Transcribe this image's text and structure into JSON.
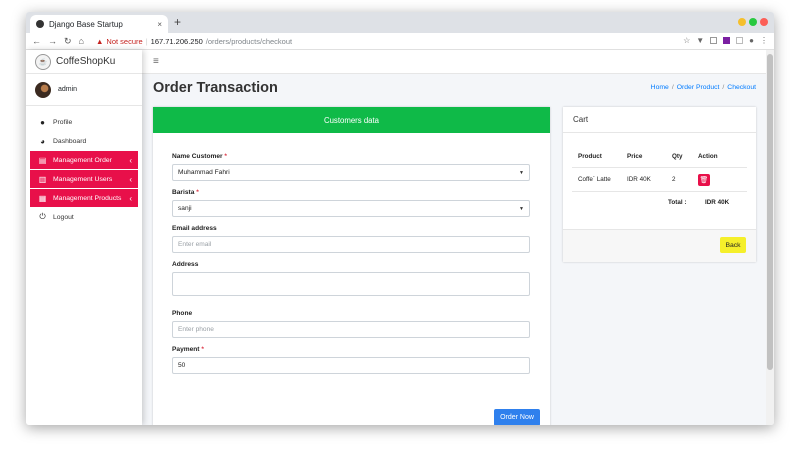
{
  "browser": {
    "tab_title": "Django Base Startup",
    "tab_close": "×",
    "new_tab": "+",
    "not_secure": "Not secure",
    "url_host": "167.71.206.250",
    "url_path": "/orders/products/checkout",
    "traffic_colors": [
      "#f5bf2c",
      "#29c940",
      "#fc5f57"
    ]
  },
  "sidebar": {
    "brand": "CoffeShopKu",
    "user": "admin",
    "items": [
      {
        "label": "Profile",
        "icon": "user-icon",
        "glyph": "👤",
        "active": false
      },
      {
        "label": "Dashboard",
        "icon": "dashboard-icon",
        "glyph": "◕",
        "active": false
      },
      {
        "label": "Management Order",
        "icon": "orders-icon",
        "glyph": "▤",
        "active": true
      },
      {
        "label": "Management Users",
        "icon": "users-icon",
        "glyph": "👥",
        "active": true
      },
      {
        "label": "Management Products",
        "icon": "boxes-icon",
        "glyph": "▦",
        "active": true
      },
      {
        "label": "Logout",
        "icon": "power-icon",
        "glyph": "⏻",
        "active": false
      }
    ]
  },
  "header": {
    "page_title": "Order Transaction",
    "breadcrumb": [
      "Home",
      "Order Product",
      "Checkout"
    ]
  },
  "customer_form": {
    "title": "Customers data",
    "name_label": "Name Customer",
    "name_value": "Muhammad Fahri",
    "barista_label": "Barista",
    "barista_value": "sanji",
    "email_label": "Email address",
    "email_placeholder": "Enter email",
    "address_label": "Address",
    "address_value": "",
    "phone_label": "Phone",
    "phone_placeholder": "Enter phone",
    "payment_label": "Payment",
    "payment_value": "50",
    "required_mark": "*",
    "submit_label": "Order Now"
  },
  "cart": {
    "title": "Cart",
    "columns": [
      "Product",
      "Price",
      "Qty",
      "Action"
    ],
    "rows": [
      {
        "product": "Coffe` Latte",
        "price": "IDR 40K",
        "qty": "2"
      }
    ],
    "total_label": "Total :",
    "total_value": "IDR 40K",
    "back_label": "Back"
  }
}
